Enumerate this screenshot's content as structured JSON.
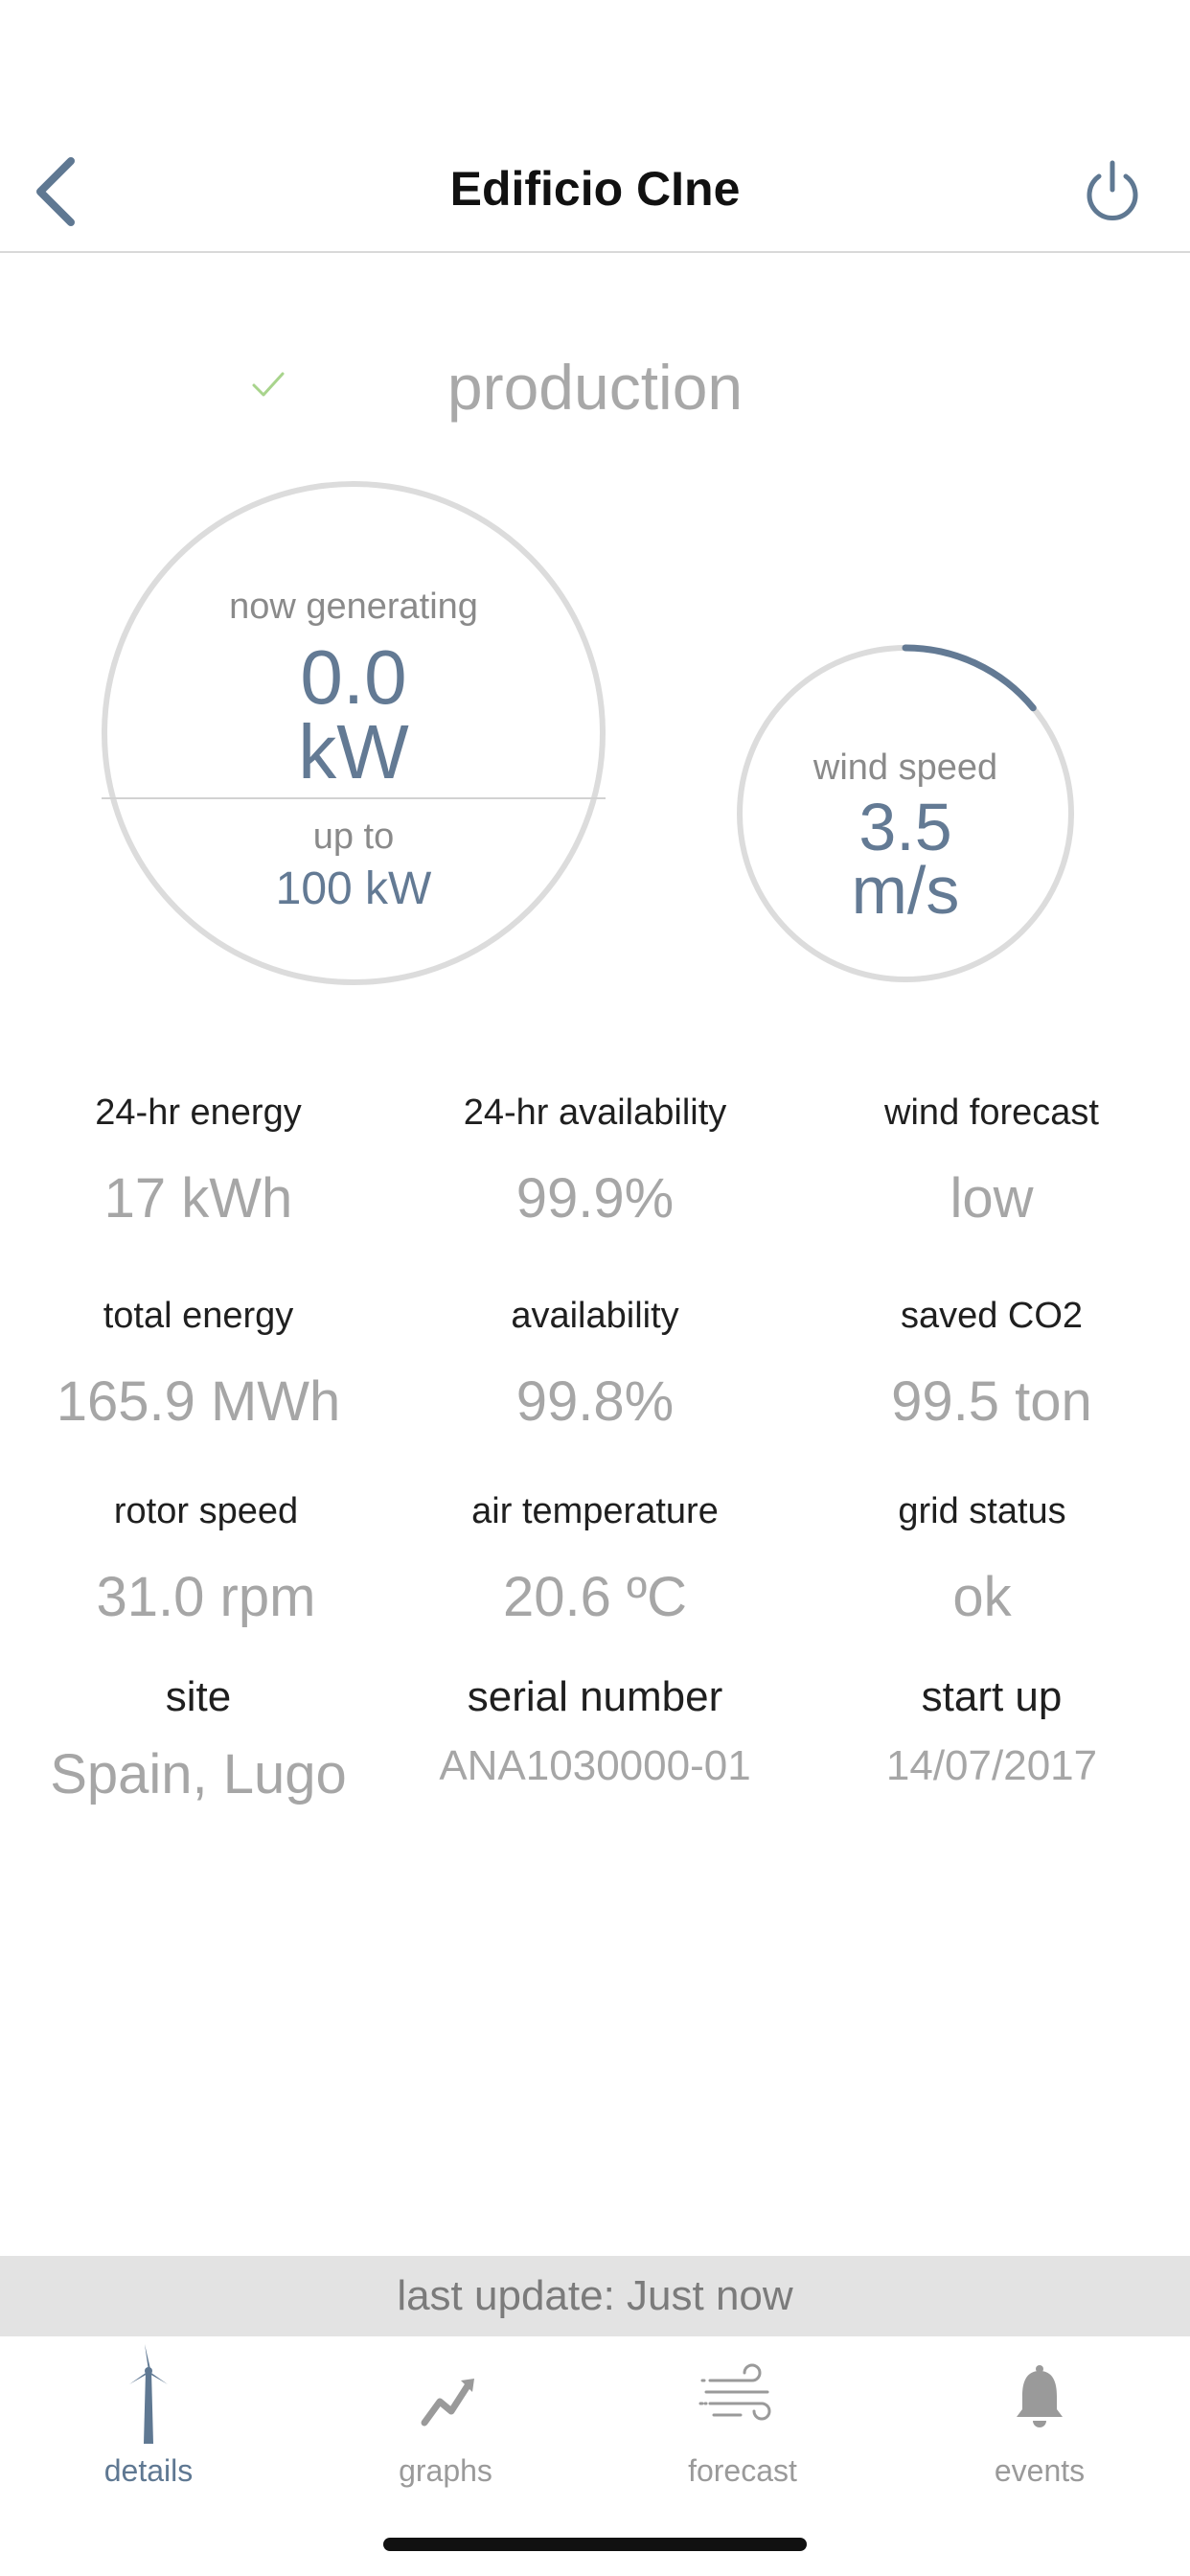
{
  "header": {
    "title": "Edificio CIne"
  },
  "status": {
    "text": "production"
  },
  "generation": {
    "label": "now generating",
    "value": "0.0",
    "unit": "kW",
    "upto_label": "up to",
    "max_value": "100 kW"
  },
  "wind": {
    "label": "wind speed",
    "value": "3.5",
    "unit": "m/s",
    "gauge_fraction": 0.14
  },
  "stats": [
    {
      "label": "24-hr energy",
      "value": "17 kWh"
    },
    {
      "label": "24-hr availability",
      "value": "99.9%"
    },
    {
      "label": "wind forecast",
      "value": "low"
    },
    {
      "label": "total energy",
      "value": "165.9 MWh"
    },
    {
      "label": "availability",
      "value": "99.8%"
    },
    {
      "label": "saved CO2",
      "value": "99.5 ton"
    },
    {
      "label": "rotor speed",
      "value": "31.0 rpm"
    },
    {
      "label": "air temperature",
      "value": "20.6 ºC"
    },
    {
      "label": "grid status",
      "value": "ok"
    },
    {
      "label": "site",
      "value": "Spain, Lugo"
    },
    {
      "label": "serial number",
      "value": "ANA1030000-01"
    },
    {
      "label": "start up",
      "value": "14/07/2017"
    }
  ],
  "update": {
    "text": "last update: Just now"
  },
  "tabs": [
    {
      "label": "details",
      "icon": "wind-turbine-icon"
    },
    {
      "label": "graphs",
      "icon": "trend-chart-icon"
    },
    {
      "label": "forecast",
      "icon": "wind-icon"
    },
    {
      "label": "events",
      "icon": "bell-icon"
    }
  ],
  "colors": {
    "accent": "#5f7892",
    "value_blue": "#637a94",
    "check_green": "#a8d48c",
    "muted": "#a6a6a6"
  }
}
